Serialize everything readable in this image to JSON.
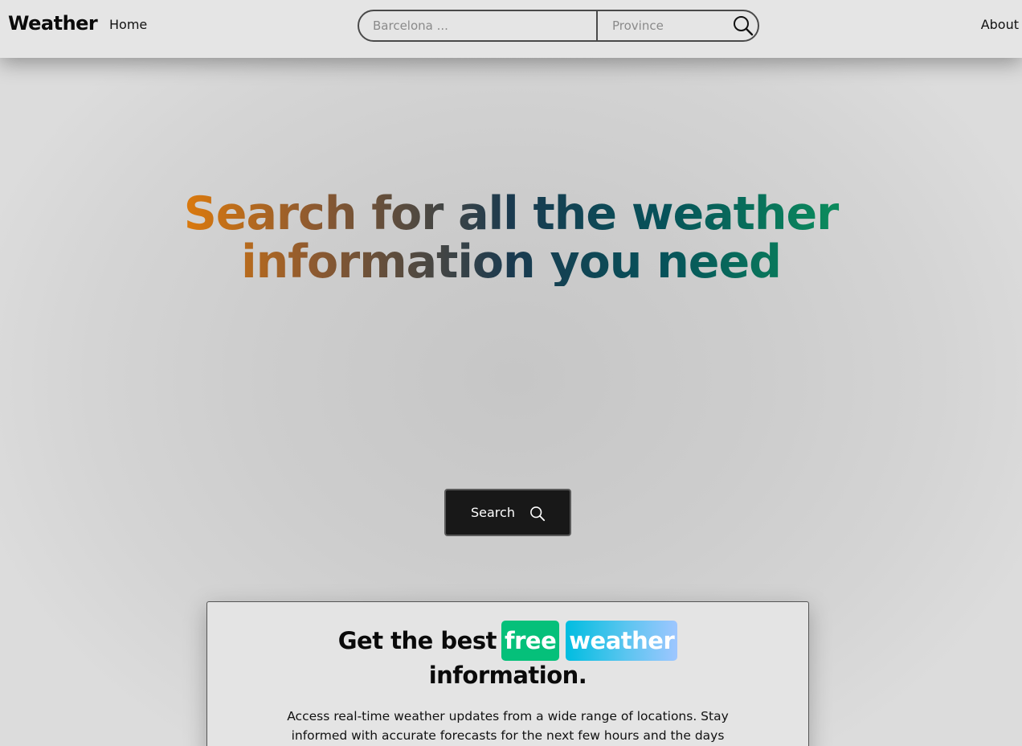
{
  "navbar": {
    "brand": "Weather",
    "home_label": "Home",
    "about_label": "About",
    "search": {
      "city_placeholder": "Barcelona ...",
      "province_placeholder": "Province",
      "icon": "search-icon"
    }
  },
  "hero": {
    "title": "Search for all the weather information you need",
    "gradient_colors": [
      "#d8780e",
      "#8e5a30",
      "#1a3a4f",
      "#06525a",
      "#0b8a5c"
    ]
  },
  "search_button": {
    "label": "Search",
    "icon": "search-icon"
  },
  "card": {
    "heading_pre": "Get the best",
    "tag_free": "free",
    "tag_weather": "weather",
    "heading_post": "information.",
    "description": "Access real-time weather updates from a wide range of locations. Stay informed with accurate forecasts for the next few hours and the days",
    "colors": {
      "free_tag": "#05c07a",
      "weather_tag_start": "#00bde0",
      "weather_tag_end": "#9ec6ff"
    }
  }
}
